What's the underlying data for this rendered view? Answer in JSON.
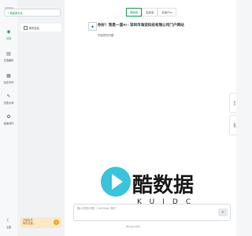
{
  "rail": {
    "items": [
      {
        "label": "对话",
        "icon": "chat-icon"
      },
      {
        "label": "文档解析",
        "icon": "document-icon"
      },
      {
        "label": "创意写作",
        "icon": "pen-icon"
      },
      {
        "label": "灵感大师",
        "icon": "feather-icon"
      },
      {
        "label": "绘画创作",
        "icon": "palette-icon"
      }
    ],
    "bottom_label": "主题"
  },
  "sidebar": {
    "new_chat": "+ 新建新对话",
    "session": "新的会话",
    "promo_line1": "开通会员",
    "promo_line2": "畅享高速..."
  },
  "tabs": [
    "基础版",
    "高级版",
    "高级Plus"
  ],
  "chat": {
    "greeting": "你好！我是一道AI - 深圳市海亚科技有限公司门户网站",
    "subtitle": "开始您的问题"
  },
  "input": {
    "placeholder": "输入您的问题，Ctrl+Enter 换行"
  },
  "footer": "服务由AI提供",
  "float": [
    "分享",
    "反馈"
  ],
  "watermark": {
    "main": "酷数据",
    "sub": "KUIDC"
  }
}
